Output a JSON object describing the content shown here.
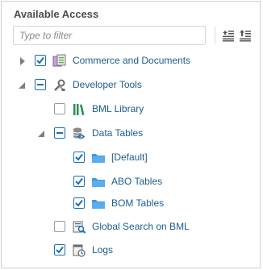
{
  "title": "Available Access",
  "filter": {
    "placeholder": "Type to filter",
    "value": ""
  },
  "toolbar": {
    "expand_all_icon": "expand-all-icon",
    "collapse_all_icon": "collapse-all-icon"
  },
  "tree": [
    {
      "label": "Commerce and Documents",
      "state": "checked",
      "expanded": false,
      "icon": "commerce-documents-icon"
    },
    {
      "label": "Developer Tools",
      "state": "partial",
      "expanded": true,
      "icon": "developer-tools-icon",
      "children": [
        {
          "label": "BML Library",
          "state": "unchecked",
          "icon": "bml-library-icon"
        },
        {
          "label": "Data Tables",
          "state": "partial",
          "expanded": true,
          "icon": "data-tables-icon",
          "children": [
            {
              "label": "[Default]",
              "state": "checked",
              "icon": "folder-icon"
            },
            {
              "label": "ABO Tables",
              "state": "checked",
              "icon": "folder-icon"
            },
            {
              "label": "BOM Tables",
              "state": "checked",
              "icon": "folder-icon"
            }
          ]
        },
        {
          "label": "Global Search on BML",
          "state": "unchecked",
          "icon": "global-search-icon"
        },
        {
          "label": "Logs",
          "state": "checked",
          "icon": "logs-icon"
        }
      ]
    }
  ],
  "colors": {
    "accent": "#1a6fb3",
    "link": "#1c5d8f",
    "folder": "#3d9be0"
  }
}
